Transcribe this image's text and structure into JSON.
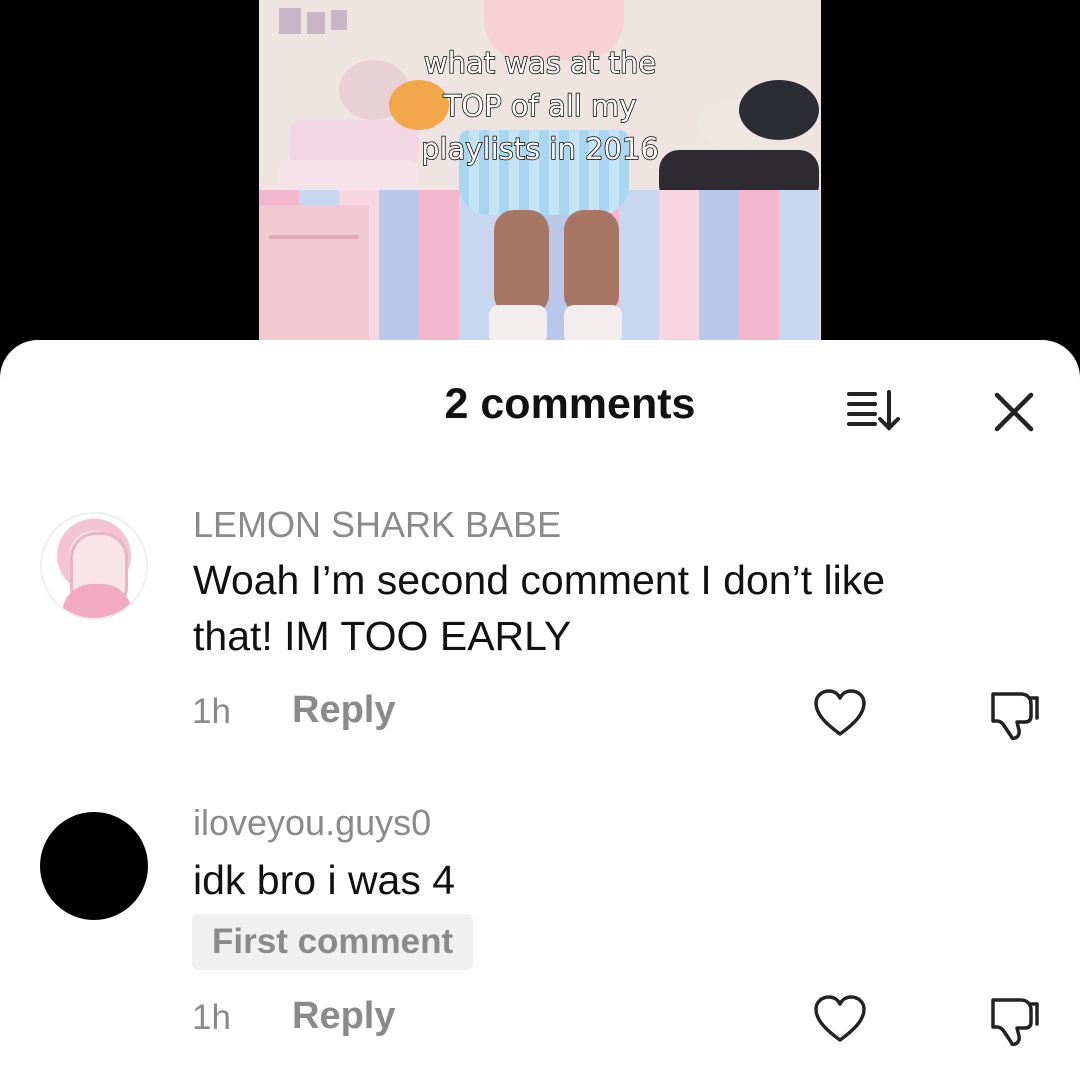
{
  "video": {
    "caption_lines": [
      "what was at the",
      "TOP of all my",
      "playlists in 2016"
    ]
  },
  "sheet": {
    "title": "2 comments",
    "sort_icon": "sort-icon",
    "close_icon": "close-icon"
  },
  "comments": [
    {
      "username": "LEMON SHARK BABE",
      "text_lines": [
        "Woah I’m second comment I don’t like",
        "that! IM TOO EARLY"
      ],
      "time": "1h",
      "reply_label": "Reply",
      "avatar": "anime-avatar"
    },
    {
      "username": "iloveyou.guys0",
      "text_lines": [
        "idk bro i was 4"
      ],
      "badge": "First comment",
      "time": "1h",
      "reply_label": "Reply",
      "avatar": "black-avatar"
    }
  ],
  "colors": {
    "background": "#000000",
    "sheet": "#ffffff",
    "muted_text": "#8a8a8a",
    "primary_text": "#111111",
    "badge_bg": "#f0f0f0"
  }
}
